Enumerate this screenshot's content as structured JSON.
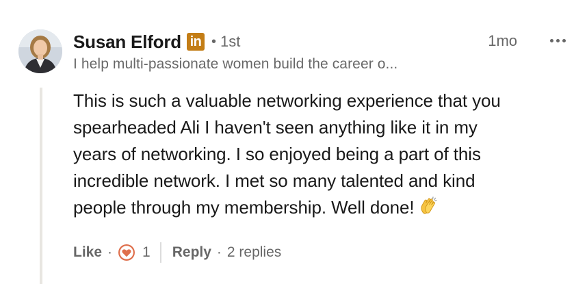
{
  "author": {
    "name": "Susan Elford",
    "badge_text": "in",
    "badge_color": "#c37d16",
    "separator": "•",
    "degree": "1st",
    "headline": "I help multi-passionate women build the career o...",
    "avatar_icon": "profile-photo"
  },
  "timestamp": "1mo",
  "more_icon": "ellipsis-icon",
  "comment": {
    "lines": [
      "This is such a valuable networking experience that you",
      "spearheaded Ali I haven't seen anything like it in my",
      "years of networking. I so enjoyed being a part of this",
      "incredible network. I met so many talented and kind",
      "people through my membership. Well done!"
    ],
    "emoji": "clapping-hands-emoji"
  },
  "actions": {
    "like_label": "Like",
    "separator": "·",
    "reaction_icon": "heart-reaction-icon",
    "reaction_color": "#df704d",
    "reaction_count": "1",
    "reply_label": "Reply",
    "replies_text": "2 replies"
  }
}
